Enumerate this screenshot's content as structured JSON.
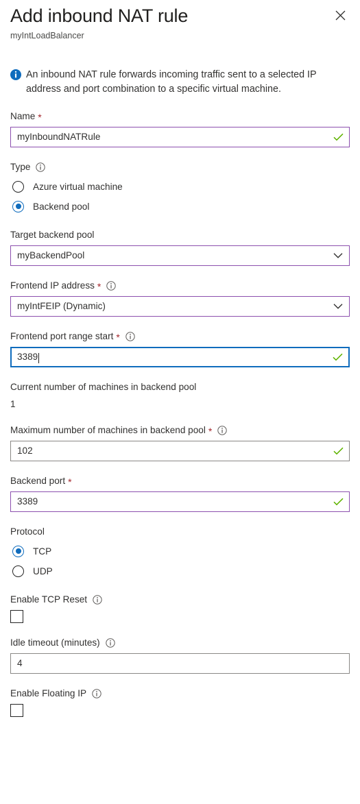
{
  "header": {
    "title": "Add inbound NAT rule",
    "subtitle": "myIntLoadBalancer",
    "close_icon": "close-icon"
  },
  "info_banner": {
    "icon": "info-filled-icon",
    "text": "An inbound NAT rule forwards incoming traffic sent to a selected IP address and port combination to a specific virtual machine."
  },
  "fields": {
    "name": {
      "label": "Name",
      "required": "*",
      "value": "myInboundNATRule",
      "valid_icon": "checkmark-icon"
    },
    "type": {
      "label": "Type",
      "info_icon": "info-outline-icon",
      "options": [
        {
          "label": "Azure virtual machine",
          "selected": false
        },
        {
          "label": "Backend pool",
          "selected": true
        }
      ]
    },
    "target_backend_pool": {
      "label": "Target backend pool",
      "value": "myBackendPool",
      "chevron_icon": "chevron-down-icon"
    },
    "frontend_ip_address": {
      "label": "Frontend IP address",
      "required": "*",
      "info_icon": "info-outline-icon",
      "value": "myIntFEIP (Dynamic)",
      "chevron_icon": "chevron-down-icon"
    },
    "frontend_port_range_start": {
      "label": "Frontend port range start",
      "required": "*",
      "info_icon": "info-outline-icon",
      "value": "3389",
      "valid_icon": "checkmark-icon"
    },
    "current_machines": {
      "label": "Current number of machines in backend pool",
      "value": "1"
    },
    "maximum_machines": {
      "label": "Maximum number of machines in backend pool",
      "required": "*",
      "info_icon": "info-outline-icon",
      "value": "102",
      "valid_icon": "checkmark-icon"
    },
    "backend_port": {
      "label": "Backend port",
      "required": "*",
      "value": "3389",
      "valid_icon": "checkmark-icon"
    },
    "protocol": {
      "label": "Protocol",
      "options": [
        {
          "label": "TCP",
          "selected": true
        },
        {
          "label": "UDP",
          "selected": false
        }
      ]
    },
    "enable_tcp_reset": {
      "label": "Enable TCP Reset",
      "info_icon": "info-outline-icon",
      "checked": false
    },
    "idle_timeout": {
      "label": "Idle timeout (minutes)",
      "info_icon": "info-outline-icon",
      "value": "4"
    },
    "enable_floating_ip": {
      "label": "Enable Floating IP",
      "info_icon": "info-outline-icon",
      "checked": false
    }
  },
  "colors": {
    "accent_blue": "#0f6cbd",
    "purple_border": "#8c4fae",
    "gray_border": "#8a8886",
    "valid_green": "#5fb300",
    "required_red": "#a4262c"
  }
}
